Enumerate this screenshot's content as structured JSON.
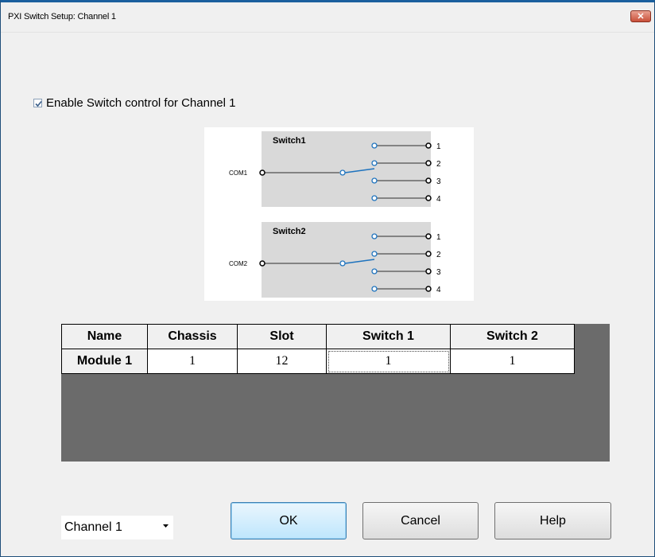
{
  "window": {
    "title": "PXI Switch Setup: Channel 1",
    "close_label": "✕"
  },
  "enable_control": {
    "label": "Enable Switch control for Channel 1",
    "checked": true
  },
  "diagram": {
    "switches": [
      {
        "title": "Switch1",
        "common": "COM1",
        "outputs": [
          "1",
          "2",
          "3",
          "4"
        ]
      },
      {
        "title": "Switch2",
        "common": "COM2",
        "outputs": [
          "1",
          "2",
          "3",
          "4"
        ]
      }
    ],
    "colors": {
      "switch_fill": "#d9d9d9",
      "contact_accent": "#1e73be",
      "wire": "#505050"
    }
  },
  "table": {
    "columns": [
      "Name",
      "Chassis",
      "Slot",
      "Switch 1",
      "Switch 2"
    ],
    "rows": [
      {
        "name": "Module 1",
        "chassis": "1",
        "slot": "12",
        "switch1": "1",
        "switch2": "1"
      }
    ]
  },
  "buttons": {
    "ok": "OK",
    "cancel": "Cancel",
    "help": "Help"
  },
  "channel_select": {
    "value": "Channel 1",
    "arrow_icon": "dropdown-arrow-icon"
  }
}
